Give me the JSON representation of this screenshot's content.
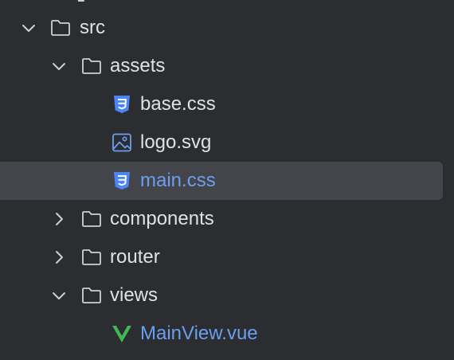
{
  "colors": {
    "background": "#2b2d30",
    "selection": "#43454a",
    "text": "#dfe1e5",
    "modified_text": "#6a9ff0",
    "folder_icon": "#ced0d6",
    "css_icon": "#4a86f7",
    "vue_icon": "#3fb950",
    "image_icon": "#6a9ff0"
  },
  "tree": {
    "src": {
      "label": "src",
      "icon": "folder-icon",
      "expanded": true
    },
    "assets": {
      "label": "assets",
      "icon": "folder-icon",
      "expanded": true
    },
    "base_css": {
      "label": "base.css",
      "icon": "css-file-icon"
    },
    "logo_svg": {
      "label": "logo.svg",
      "icon": "image-file-icon"
    },
    "main_css": {
      "label": "main.css",
      "icon": "css-file-icon",
      "selected": true
    },
    "components": {
      "label": "components",
      "icon": "folder-icon",
      "expanded": false
    },
    "router": {
      "label": "router",
      "icon": "folder-icon",
      "expanded": false
    },
    "views": {
      "label": "views",
      "icon": "folder-icon",
      "expanded": true
    },
    "mainview_vue": {
      "label": "MainView.vue",
      "icon": "vue-file-icon"
    }
  }
}
